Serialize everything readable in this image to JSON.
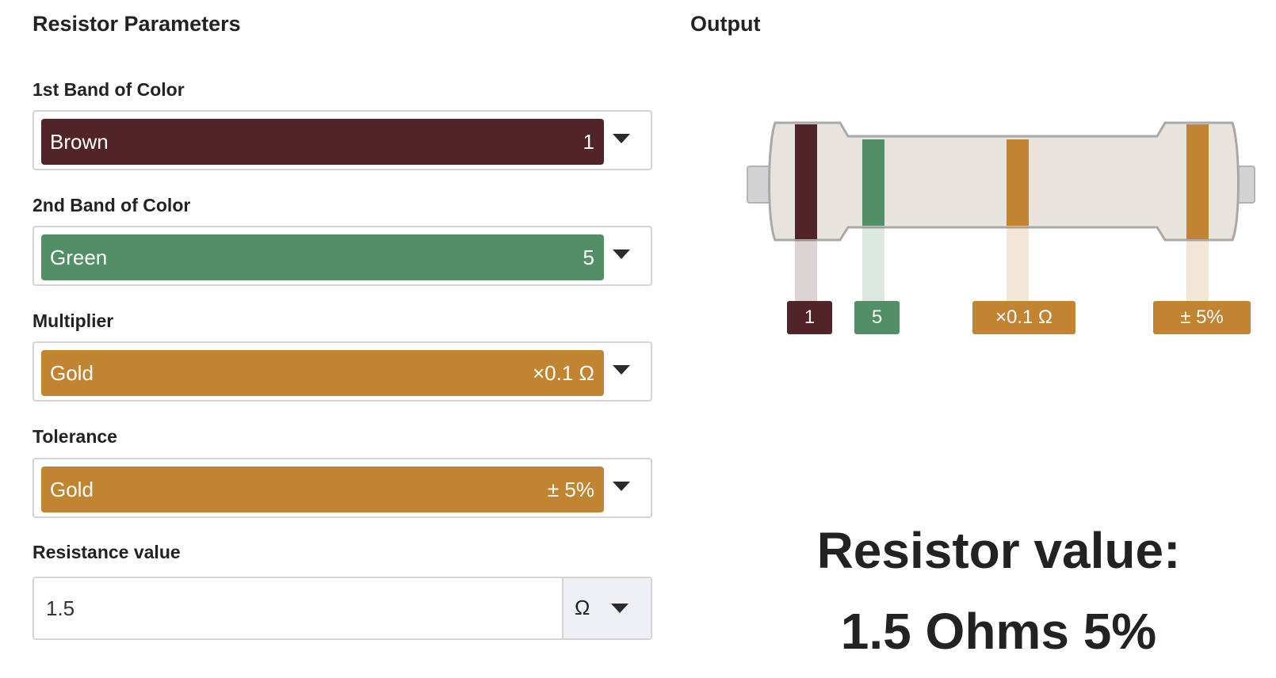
{
  "headings": {
    "parameters": "Resistor Parameters",
    "output": "Output"
  },
  "fields": {
    "band1": {
      "label": "1st Band of Color",
      "color_name": "Brown",
      "value": "1",
      "color": "#502428"
    },
    "band2": {
      "label": "2nd Band of Color",
      "color_name": "Green",
      "value": "5",
      "color": "#528e66"
    },
    "multiplier": {
      "label": "Multiplier",
      "color_name": "Gold",
      "value": "×0.1 Ω",
      "color": "#c08432"
    },
    "tolerance": {
      "label": "Tolerance",
      "color_name": "Gold",
      "value": "± 5%",
      "color": "#c08432"
    }
  },
  "resistance": {
    "label": "Resistance value",
    "value": "1.5",
    "unit": "Ω"
  },
  "diagram": {
    "tags": [
      "1",
      "5",
      "×0.1 Ω",
      "± 5%"
    ],
    "body_color": "#e8e4dd",
    "lead_color": "#d3d3d3"
  },
  "result": {
    "title": "Resistor value:",
    "value": "1.5 Ohms 5%"
  },
  "icons": [
    "chevron-down-icon",
    "resistor-diagram"
  ]
}
